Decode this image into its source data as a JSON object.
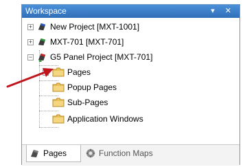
{
  "window": {
    "title": "Workspace",
    "controls": "▾ ✕"
  },
  "tree": [
    {
      "label": "New Project [MXT-1001]",
      "expanded": false,
      "type": "project"
    },
    {
      "label": "MXT-701 [MXT-701]",
      "expanded": false,
      "type": "project"
    },
    {
      "label": "G5 Panel Project [MXT-701]",
      "expanded": true,
      "type": "project"
    },
    {
      "label": "Pages",
      "type": "folder"
    },
    {
      "label": "Popup Pages",
      "type": "folder"
    },
    {
      "label": "Sub-Pages",
      "type": "folder"
    },
    {
      "label": "Application Windows",
      "type": "folder"
    }
  ],
  "tabs": [
    {
      "label": "Pages",
      "active": true,
      "icon": "pages-icon"
    },
    {
      "label": "Function Maps",
      "active": false,
      "icon": "function-maps-icon"
    }
  ],
  "colors": {
    "titlebar": "#3f84cf",
    "arrow": "#c0151c",
    "folder": "#e8c15a"
  }
}
